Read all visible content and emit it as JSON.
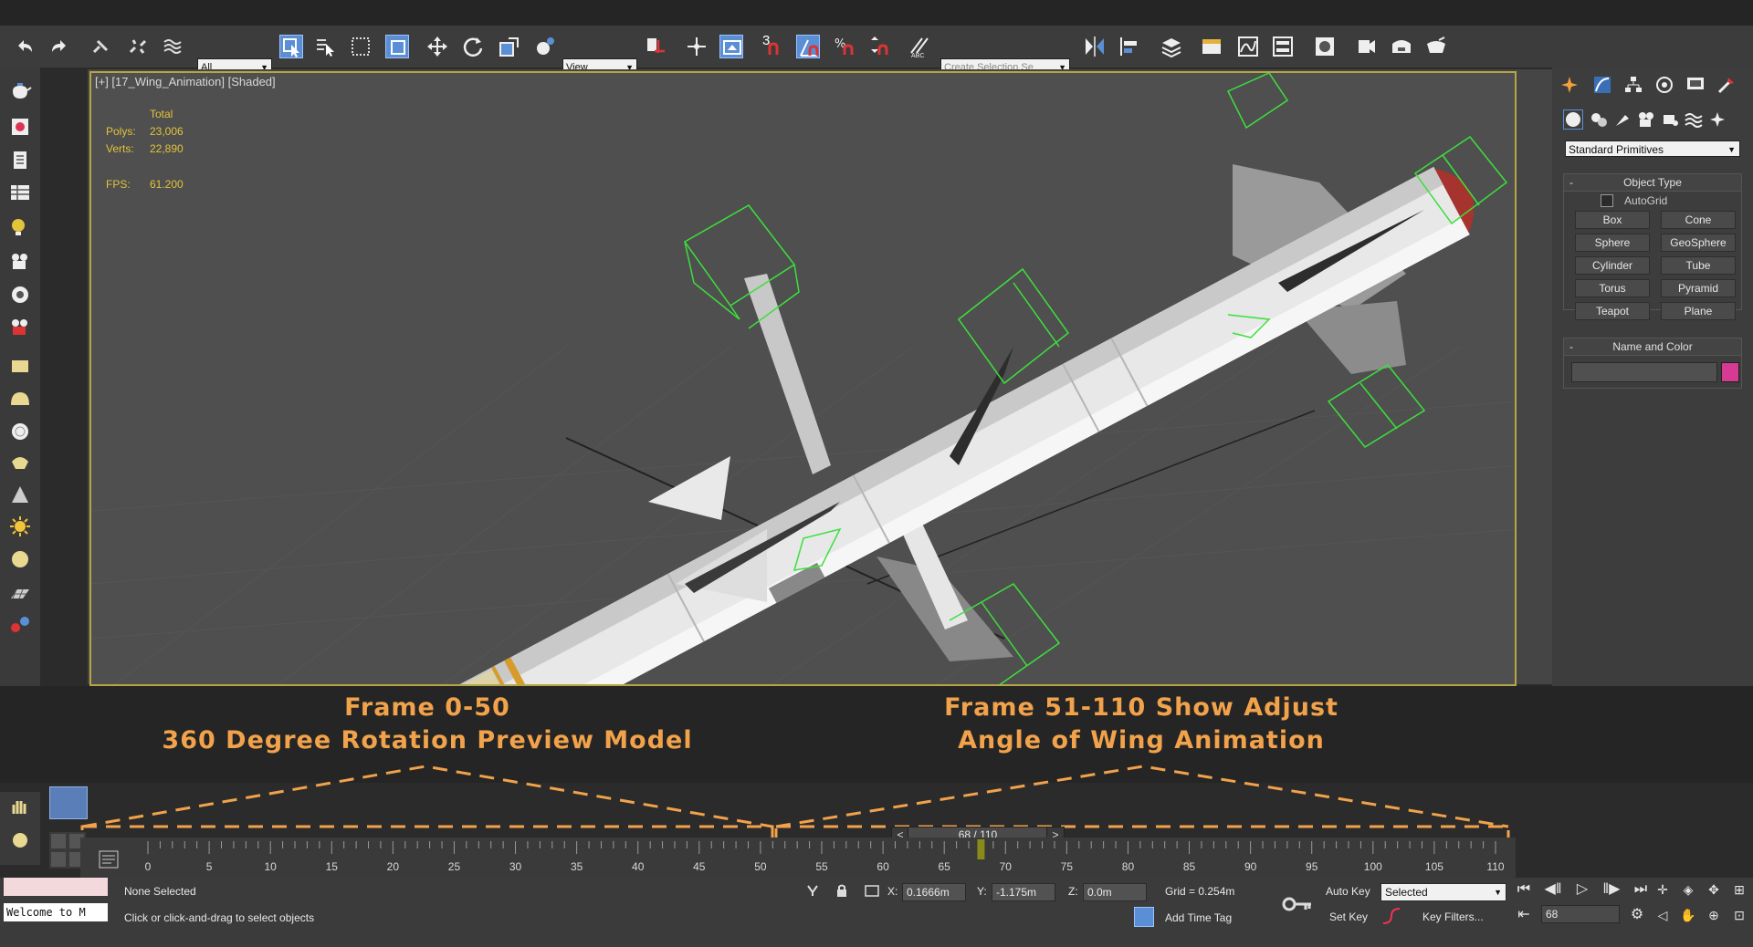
{
  "toolbar": {
    "selection_filter": "All",
    "ref_coord": "View",
    "snap_3_label": "3",
    "named_selection_placeholder": "Create Selection Se"
  },
  "viewport": {
    "label": "[+] [17_Wing_Animation] [Shaded]",
    "stats": {
      "total_label": "Total",
      "polys_label": "Polys:",
      "polys_value": "23,006",
      "verts_label": "Verts:",
      "verts_value": "22,890",
      "fps_label": "FPS:",
      "fps_value": "61.200"
    }
  },
  "command_panel": {
    "category": "Standard Primitives",
    "object_type_title": "Object Type",
    "autogrid_label": "AutoGrid",
    "primitives": [
      "Box",
      "Cone",
      "Sphere",
      "GeoSphere",
      "Cylinder",
      "Tube",
      "Torus",
      "Pyramid",
      "Teapot",
      "Plane"
    ],
    "name_color_title": "Name and Color",
    "object_color": "#d63a92"
  },
  "overlay": {
    "left_line1": "Frame 0-50",
    "left_line2": "360 Degree Rotation Preview Model",
    "right_line1": "Frame 51-110 Show Adjust",
    "right_line2": "Angle of Wing Animation",
    "accent_color": "#f1a24a"
  },
  "timeline": {
    "frame_display": "68 / 110",
    "prev_label": "<",
    "next_label": ">",
    "current_frame": 68,
    "total_frames": 110,
    "ticks": [
      "0",
      "5",
      "10",
      "15",
      "20",
      "25",
      "30",
      "35",
      "40",
      "45",
      "50",
      "55",
      "60",
      "65",
      "70",
      "75",
      "80",
      "85",
      "90",
      "95",
      "100",
      "105",
      "110"
    ]
  },
  "status": {
    "welcome": "Welcome to M",
    "selection": "None Selected",
    "prompt": "Click or click-and-drag to select objects",
    "x_label": "X:",
    "x_value": "0.1666m",
    "y_label": "Y:",
    "y_value": "-1.175m",
    "z_label": "Z:",
    "z_value": "0.0m",
    "grid": "Grid = 0.254m",
    "add_time_tag": "Add Time Tag",
    "auto_key": "Auto Key",
    "set_key": "Set Key",
    "key_mode": "Selected",
    "key_filters": "Key Filters...",
    "frame_field": "68"
  }
}
